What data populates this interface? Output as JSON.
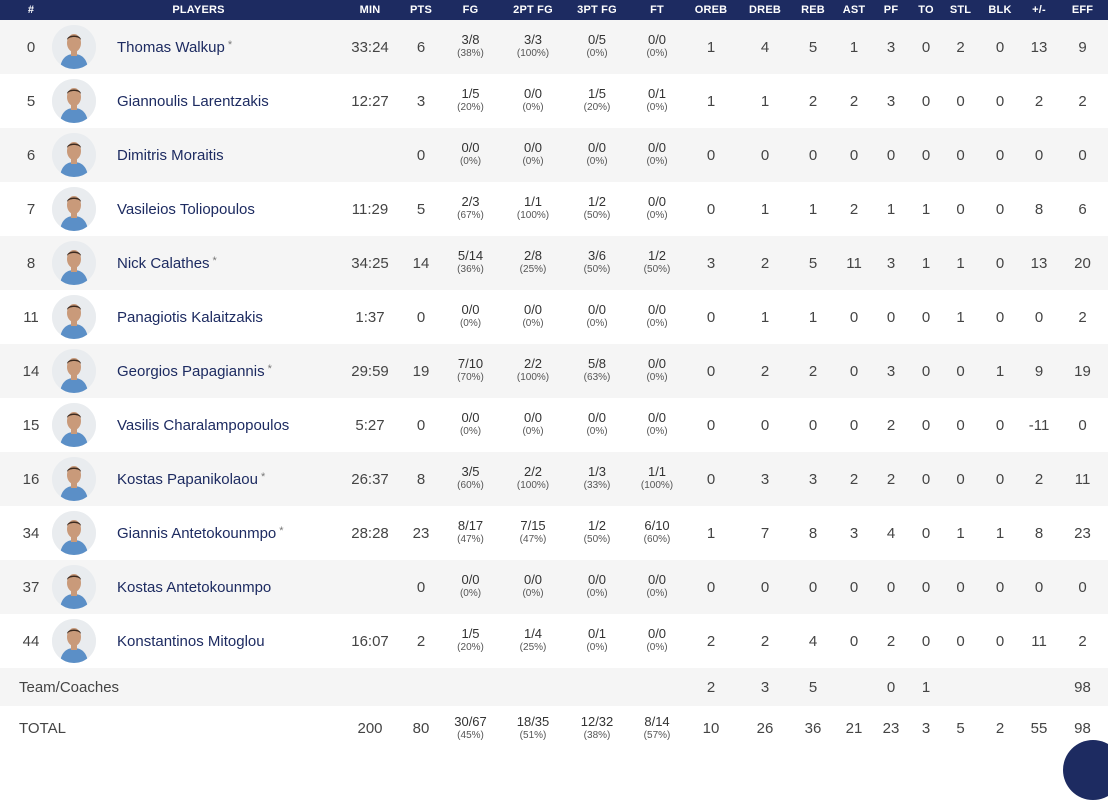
{
  "headers": {
    "num": "#",
    "players": "PLAYERS",
    "min": "MIN",
    "pts": "PTS",
    "fg": "FG",
    "fg2": "2PT FG",
    "fg3": "3PT FG",
    "ft": "FT",
    "oreb": "OREB",
    "dreb": "DREB",
    "reb": "REB",
    "ast": "AST",
    "pf": "PF",
    "to": "TO",
    "stl": "STL",
    "blk": "BLK",
    "pm": "+/-",
    "eff": "EFF"
  },
  "players": [
    {
      "num": "0",
      "name": "Thomas Walkup",
      "starter": "*",
      "min": "33:24",
      "pts": "6",
      "fg": "3/8",
      "fg_pct": "(38%)",
      "fg2": "3/3",
      "fg2_pct": "(100%)",
      "fg3": "0/5",
      "fg3_pct": "(0%)",
      "ft": "0/0",
      "ft_pct": "(0%)",
      "oreb": "1",
      "dreb": "4",
      "reb": "5",
      "ast": "1",
      "pf": "3",
      "to": "0",
      "stl": "2",
      "blk": "0",
      "pm": "13",
      "eff": "9"
    },
    {
      "num": "5",
      "name": "Giannoulis Larentzakis",
      "starter": "",
      "min": "12:27",
      "pts": "3",
      "fg": "1/5",
      "fg_pct": "(20%)",
      "fg2": "0/0",
      "fg2_pct": "(0%)",
      "fg3": "1/5",
      "fg3_pct": "(20%)",
      "ft": "0/1",
      "ft_pct": "(0%)",
      "oreb": "1",
      "dreb": "1",
      "reb": "2",
      "ast": "2",
      "pf": "3",
      "to": "0",
      "stl": "0",
      "blk": "0",
      "pm": "2",
      "eff": "2"
    },
    {
      "num": "6",
      "name": "Dimitris Moraitis",
      "starter": "",
      "min": "",
      "pts": "0",
      "fg": "0/0",
      "fg_pct": "(0%)",
      "fg2": "0/0",
      "fg2_pct": "(0%)",
      "fg3": "0/0",
      "fg3_pct": "(0%)",
      "ft": "0/0",
      "ft_pct": "(0%)",
      "oreb": "0",
      "dreb": "0",
      "reb": "0",
      "ast": "0",
      "pf": "0",
      "to": "0",
      "stl": "0",
      "blk": "0",
      "pm": "0",
      "eff": "0"
    },
    {
      "num": "7",
      "name": "Vasileios Toliopoulos",
      "starter": "",
      "min": "11:29",
      "pts": "5",
      "fg": "2/3",
      "fg_pct": "(67%)",
      "fg2": "1/1",
      "fg2_pct": "(100%)",
      "fg3": "1/2",
      "fg3_pct": "(50%)",
      "ft": "0/0",
      "ft_pct": "(0%)",
      "oreb": "0",
      "dreb": "1",
      "reb": "1",
      "ast": "2",
      "pf": "1",
      "to": "1",
      "stl": "0",
      "blk": "0",
      "pm": "8",
      "eff": "6"
    },
    {
      "num": "8",
      "name": "Nick Calathes",
      "starter": "*",
      "min": "34:25",
      "pts": "14",
      "fg": "5/14",
      "fg_pct": "(36%)",
      "fg2": "2/8",
      "fg2_pct": "(25%)",
      "fg3": "3/6",
      "fg3_pct": "(50%)",
      "ft": "1/2",
      "ft_pct": "(50%)",
      "oreb": "3",
      "dreb": "2",
      "reb": "5",
      "ast": "11",
      "pf": "3",
      "to": "1",
      "stl": "1",
      "blk": "0",
      "pm": "13",
      "eff": "20"
    },
    {
      "num": "11",
      "name": "Panagiotis Kalaitzakis",
      "starter": "",
      "min": "1:37",
      "pts": "0",
      "fg": "0/0",
      "fg_pct": "(0%)",
      "fg2": "0/0",
      "fg2_pct": "(0%)",
      "fg3": "0/0",
      "fg3_pct": "(0%)",
      "ft": "0/0",
      "ft_pct": "(0%)",
      "oreb": "0",
      "dreb": "1",
      "reb": "1",
      "ast": "0",
      "pf": "0",
      "to": "0",
      "stl": "1",
      "blk": "0",
      "pm": "0",
      "eff": "2"
    },
    {
      "num": "14",
      "name": "Georgios Papagiannis",
      "starter": "*",
      "min": "29:59",
      "pts": "19",
      "fg": "7/10",
      "fg_pct": "(70%)",
      "fg2": "2/2",
      "fg2_pct": "(100%)",
      "fg3": "5/8",
      "fg3_pct": "(63%)",
      "ft": "0/0",
      "ft_pct": "(0%)",
      "oreb": "0",
      "dreb": "2",
      "reb": "2",
      "ast": "0",
      "pf": "3",
      "to": "0",
      "stl": "0",
      "blk": "1",
      "pm": "9",
      "eff": "19"
    },
    {
      "num": "15",
      "name": "Vasilis Charalampopoulos",
      "starter": "",
      "min": "5:27",
      "pts": "0",
      "fg": "0/0",
      "fg_pct": "(0%)",
      "fg2": "0/0",
      "fg2_pct": "(0%)",
      "fg3": "0/0",
      "fg3_pct": "(0%)",
      "ft": "0/0",
      "ft_pct": "(0%)",
      "oreb": "0",
      "dreb": "0",
      "reb": "0",
      "ast": "0",
      "pf": "2",
      "to": "0",
      "stl": "0",
      "blk": "0",
      "pm": "-11",
      "eff": "0"
    },
    {
      "num": "16",
      "name": "Kostas Papanikolaou",
      "starter": "*",
      "min": "26:37",
      "pts": "8",
      "fg": "3/5",
      "fg_pct": "(60%)",
      "fg2": "2/2",
      "fg2_pct": "(100%)",
      "fg3": "1/3",
      "fg3_pct": "(33%)",
      "ft": "1/1",
      "ft_pct": "(100%)",
      "oreb": "0",
      "dreb": "3",
      "reb": "3",
      "ast": "2",
      "pf": "2",
      "to": "0",
      "stl": "0",
      "blk": "0",
      "pm": "2",
      "eff": "11"
    },
    {
      "num": "34",
      "name": "Giannis Antetokounmpo",
      "starter": "*",
      "min": "28:28",
      "pts": "23",
      "fg": "8/17",
      "fg_pct": "(47%)",
      "fg2": "7/15",
      "fg2_pct": "(47%)",
      "fg3": "1/2",
      "fg3_pct": "(50%)",
      "ft": "6/10",
      "ft_pct": "(60%)",
      "oreb": "1",
      "dreb": "7",
      "reb": "8",
      "ast": "3",
      "pf": "4",
      "to": "0",
      "stl": "1",
      "blk": "1",
      "pm": "8",
      "eff": "23"
    },
    {
      "num": "37",
      "name": "Kostas Antetokounmpo",
      "starter": "",
      "min": "",
      "pts": "0",
      "fg": "0/0",
      "fg_pct": "(0%)",
      "fg2": "0/0",
      "fg2_pct": "(0%)",
      "fg3": "0/0",
      "fg3_pct": "(0%)",
      "ft": "0/0",
      "ft_pct": "(0%)",
      "oreb": "0",
      "dreb": "0",
      "reb": "0",
      "ast": "0",
      "pf": "0",
      "to": "0",
      "stl": "0",
      "blk": "0",
      "pm": "0",
      "eff": "0"
    },
    {
      "num": "44",
      "name": "Konstantinos Mitoglou",
      "starter": "",
      "min": "16:07",
      "pts": "2",
      "fg": "1/5",
      "fg_pct": "(20%)",
      "fg2": "1/4",
      "fg2_pct": "(25%)",
      "fg3": "0/1",
      "fg3_pct": "(0%)",
      "ft": "0/0",
      "ft_pct": "(0%)",
      "oreb": "2",
      "dreb": "2",
      "reb": "4",
      "ast": "0",
      "pf": "2",
      "to": "0",
      "stl": "0",
      "blk": "0",
      "pm": "11",
      "eff": "2"
    }
  ],
  "team": {
    "label": "Team/Coaches",
    "oreb": "2",
    "dreb": "3",
    "reb": "5",
    "pf": "0",
    "to": "1",
    "eff": "98"
  },
  "total": {
    "label": "TOTAL",
    "min": "200",
    "pts": "80",
    "fg": "30/67",
    "fg_pct": "(45%)",
    "fg2": "18/35",
    "fg2_pct": "(51%)",
    "fg3": "12/32",
    "fg3_pct": "(38%)",
    "ft": "8/14",
    "ft_pct": "(57%)",
    "oreb": "10",
    "dreb": "26",
    "reb": "36",
    "ast": "21",
    "pf": "23",
    "to": "3",
    "stl": "5",
    "blk": "2",
    "pm": "55",
    "eff": "98"
  },
  "colors": {
    "header_bg": "#1d2b61",
    "name_color": "#1d2b61",
    "accent_red": "#c8102e",
    "row_alt": "#f5f5f5"
  },
  "icons": {
    "avatar": "player-avatar-icon",
    "scroll": "scroll-to-top-button"
  }
}
